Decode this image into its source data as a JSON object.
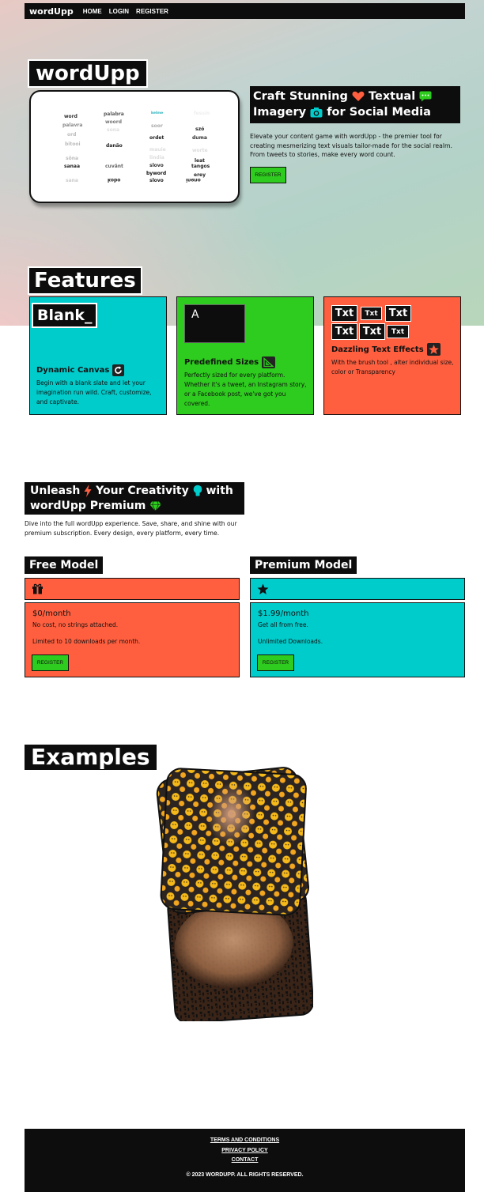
{
  "nav": {
    "brand": "wordUpp",
    "links": [
      "HOME",
      "LOGIN",
      "REGISTER"
    ]
  },
  "hero": {
    "title": "wordUpp",
    "craft_line1": "Craft Stunning",
    "craft_line1b": "Textual",
    "craft_line2": "Imagery",
    "craft_line2b": "for Social Media",
    "description": "Elevate your content game with wordUpp - the premier tool for creating mesmerizing text visuals tailor-made for the social realm. From tweets to stories, make every word count.",
    "register_label": "REGISTER",
    "words": [
      "word",
      "palabra",
      "woord",
      "palavra",
      "ord",
      "kelme",
      "szó",
      "danão",
      "ordet",
      "duma",
      "sõna",
      "slovo",
      "leat",
      "tangos",
      "sanaa",
      "cuvânt",
      "byword",
      "slovo",
      "erey",
      "kobo",
      "sana",
      "bitooi",
      "sona",
      "fessin",
      "soor",
      "worte",
      "lindia",
      "mauie",
      "ineno"
    ]
  },
  "features": {
    "title": "Features",
    "items": [
      {
        "tile": "Blank_",
        "title": "Dynamic Canvas",
        "icon": "refresh-icon",
        "text": "Begin with a blank slate and let your imagination run wild. Craft, customize, and captivate."
      },
      {
        "tile": "A",
        "title": "Predefined Sizes",
        "icon": "ruler-triangle-icon",
        "text": "Perfectly sized for every platform. Whether it's a tweet, an Instagram story, or a Facebook post, we've got you covered."
      },
      {
        "tile": "Txt",
        "title": "Dazzling Text Effects",
        "icon": "sparkle-star-icon",
        "text": "With the brush tool , alter individual size, color or Transparency"
      }
    ]
  },
  "premium": {
    "title_a": "Unleash",
    "title_b": "Your Creativity",
    "title_c": "with",
    "title_d": "wordUpp Premium",
    "description": "Dive into the full wordUpp experience. Save, share, and shine with our premium subscription. Every design, every platform, every time.",
    "plans": [
      {
        "title": "Free Model",
        "icon": "gift-icon",
        "price": "$0/month",
        "line1": "No cost, no strings attached.",
        "line2": "Limited to 10 downloads per month.",
        "button": "REGISTER",
        "color": "#ff5f3f"
      },
      {
        "title": "Premium Model",
        "icon": "star-icon",
        "price": "$1.99/month",
        "line1": "Get all from free.",
        "line2": "Unlimited Downloads.",
        "button": "REGISTER",
        "color": "#00cccc"
      }
    ]
  },
  "examples": {
    "title": "Examples"
  },
  "footer": {
    "terms": "TERMS AND CONDITIONS",
    "privacy": "PRIVACY POLICY",
    "contact": "CONTACT",
    "copyright": "© 2023 WORDUPP. ALL RIGHTS RESERVED."
  },
  "colors": {
    "orange": "#ff5f3f",
    "cyan": "#00cccc",
    "green": "#2ecc1e",
    "black": "#0d0d0d"
  }
}
